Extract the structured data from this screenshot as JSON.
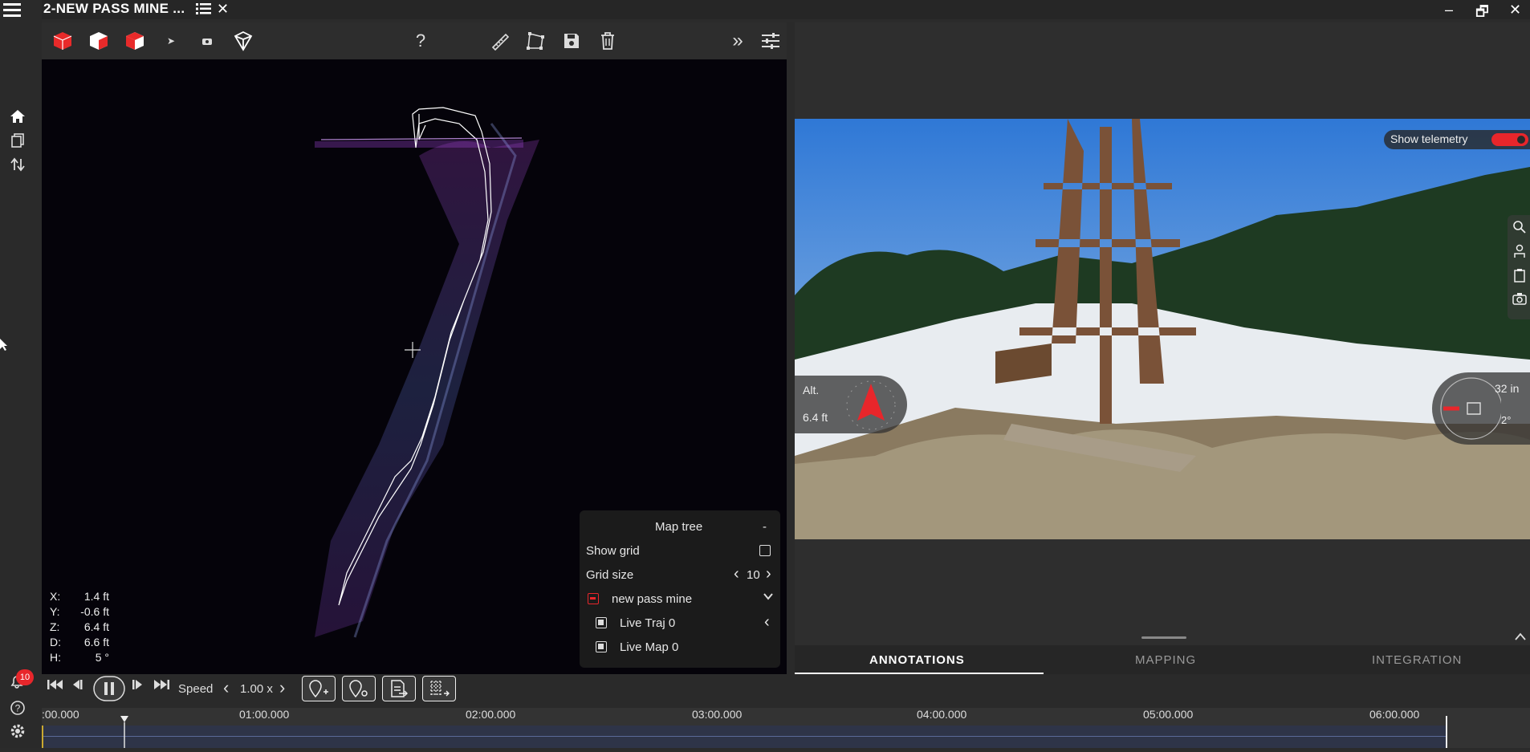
{
  "window": {
    "title": "2-NEW PASS MINE ...",
    "minimize": "–",
    "maximize": "🗗",
    "close": "✕"
  },
  "toolbar": {
    "help_label": "?"
  },
  "map": {
    "coords": [
      {
        "key": "X:",
        "value": "1.4 ft"
      },
      {
        "key": "Y:",
        "value": "-0.6 ft"
      },
      {
        "key": "Z:",
        "value": "6.4 ft"
      },
      {
        "key": "D:",
        "value": "6.6 ft"
      },
      {
        "key": "H:",
        "value": "5 °"
      }
    ],
    "map_tree": {
      "title": "Map tree",
      "collapse": "-",
      "show_grid_label": "Show grid",
      "grid_size_label": "Grid size",
      "grid_size_value": "10",
      "layers": [
        {
          "label": "new pass mine"
        },
        {
          "label": "Live Traj 0"
        },
        {
          "label": "Live Map 0"
        }
      ]
    }
  },
  "video": {
    "show_telemetry_label": "Show telemetry",
    "alt_label": "Alt.",
    "alt_value": "6.4 ft",
    "depth_value": "32 in",
    "angle_value": "2°"
  },
  "tabs": [
    {
      "label": "ANNOTATIONS",
      "active": true
    },
    {
      "label": "MAPPING",
      "active": false
    },
    {
      "label": "INTEGRATION",
      "active": false
    }
  ],
  "playback": {
    "speed_label": "Speed",
    "speed_value": "1.00 x"
  },
  "timeline": {
    "labels": [
      ":00.000",
      "01:00.000",
      "02:00.000",
      "03:00.000",
      "04:00.000",
      "05:00.000",
      "06:00.000"
    ],
    "playhead_fraction": 0.059
  },
  "notifications": {
    "count": "10"
  },
  "colors": {
    "accent": "#e8262b",
    "active_tab_underline": "#ffffff"
  }
}
